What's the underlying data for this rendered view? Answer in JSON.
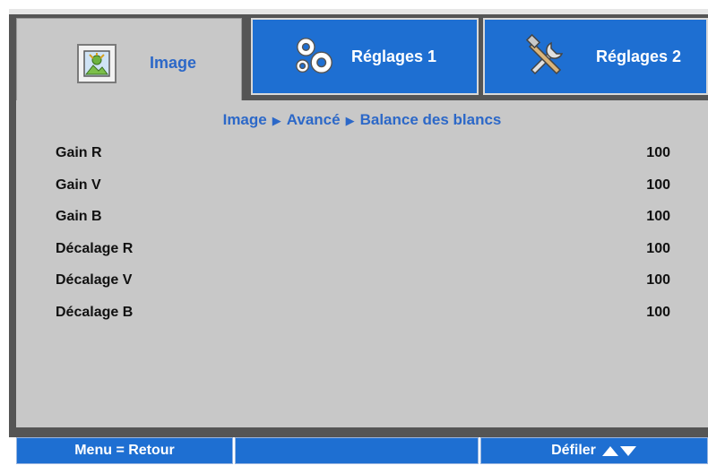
{
  "tabs": [
    {
      "label": "Image",
      "icon": "image-settings-icon",
      "active": true
    },
    {
      "label": "Réglages 1",
      "icon": "gears-icon",
      "active": false
    },
    {
      "label": "Réglages 2",
      "icon": "tools-icon",
      "active": false
    }
  ],
  "breadcrumb": {
    "items": [
      "Image",
      "Avancé",
      "Balance des blancs"
    ],
    "separator": "▶"
  },
  "settings": [
    {
      "label": "Gain R",
      "value": "100"
    },
    {
      "label": "Gain V",
      "value": "100"
    },
    {
      "label": "Gain B",
      "value": "100"
    },
    {
      "label": "Décalage R",
      "value": "100"
    },
    {
      "label": "Décalage V",
      "value": "100"
    },
    {
      "label": "Décalage B",
      "value": "100"
    }
  ],
  "footer": {
    "back": "Menu = Retour",
    "middle": "",
    "scroll": "Défiler"
  },
  "colors": {
    "accent": "#2c68c8",
    "tab_blue": "#1e6fd2",
    "panel_gray": "#c8c8c8",
    "frame_dark": "#555555"
  }
}
